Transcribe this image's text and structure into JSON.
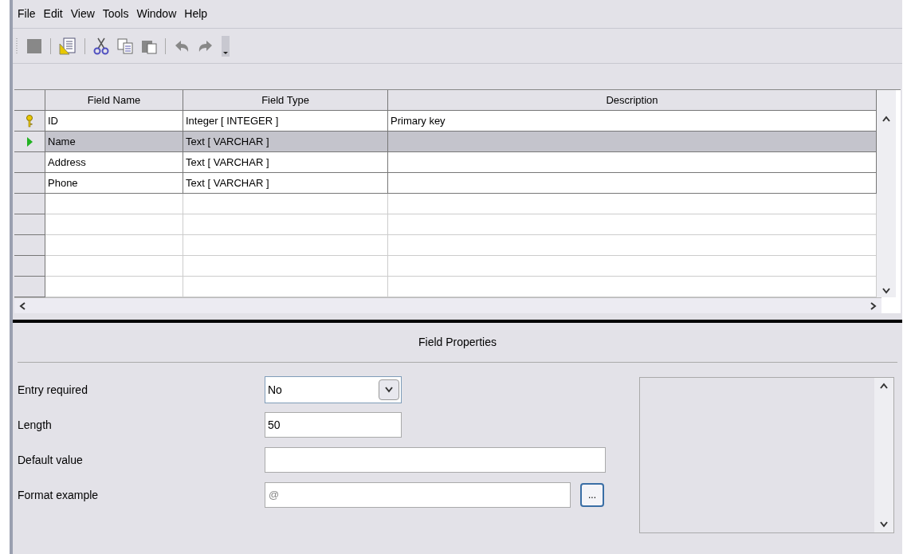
{
  "menu": [
    "File",
    "Edit",
    "View",
    "Tools",
    "Window",
    "Help"
  ],
  "table": {
    "columns": [
      "Field Name",
      "Field Type",
      "Description"
    ],
    "rows": [
      {
        "primary_key": true,
        "selected": false,
        "cells": [
          "ID",
          "Integer [ INTEGER ]",
          "Primary key"
        ]
      },
      {
        "primary_key": false,
        "selected": true,
        "cells": [
          "Name",
          "Text [ VARCHAR ]",
          ""
        ]
      },
      {
        "primary_key": false,
        "selected": false,
        "cells": [
          "Address",
          "Text [ VARCHAR ]",
          ""
        ]
      },
      {
        "primary_key": false,
        "selected": false,
        "cells": [
          "Phone",
          "Text [ VARCHAR ]",
          ""
        ]
      }
    ]
  },
  "field_properties": {
    "title": "Field Properties",
    "rows": [
      {
        "kind": "dropdown",
        "label": "Entry required",
        "value": "No"
      },
      {
        "kind": "input",
        "label": "Length",
        "value": "50"
      },
      {
        "kind": "input",
        "label": "Default value",
        "value": ""
      },
      {
        "kind": "format",
        "label": "Format example",
        "value": "@",
        "button": "..."
      }
    ]
  }
}
